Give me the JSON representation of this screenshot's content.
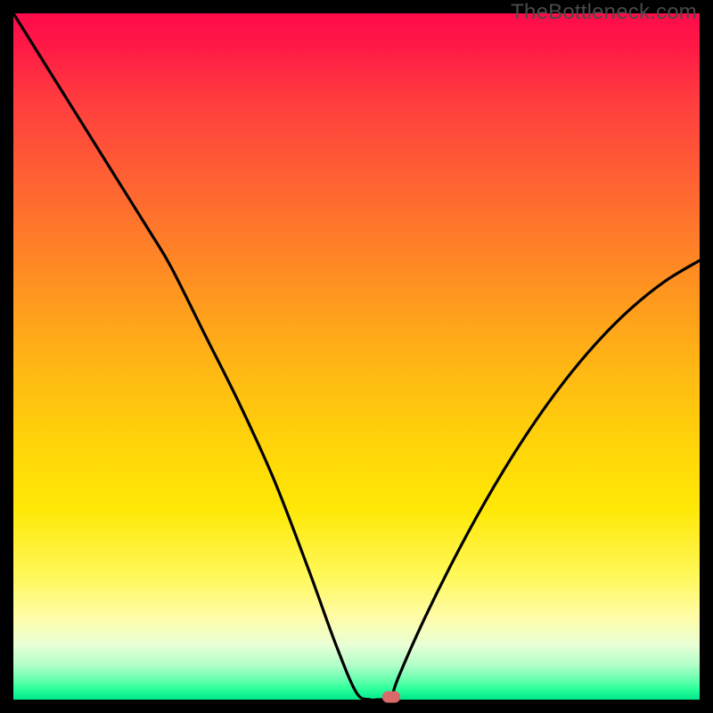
{
  "watermark": "TheBottleneck.com",
  "chart_data": {
    "type": "line",
    "title": "",
    "xlabel": "",
    "ylabel": "",
    "xlim": [
      0,
      100
    ],
    "ylim": [
      0,
      100
    ],
    "grid": false,
    "legend": false,
    "background_gradient": {
      "top": "#ff0a4a",
      "bottom": "#00e88a",
      "description": "red-to-green vertical gradient (bottleneck severity scale)"
    },
    "series": [
      {
        "name": "bottleneck-curve",
        "color": "#000000",
        "x": [
          0,
          5,
          10,
          15,
          20,
          23,
          28,
          33,
          38,
          43,
          47,
          50,
          52,
          53,
          54,
          55,
          56,
          60,
          65,
          70,
          75,
          80,
          85,
          90,
          95,
          100
        ],
        "values": [
          100,
          92,
          84,
          76,
          68,
          63,
          53,
          43,
          32,
          19,
          8,
          1,
          0,
          0,
          0,
          0,
          3,
          12,
          22,
          31,
          39,
          46,
          52,
          57,
          61,
          64
        ]
      }
    ],
    "marker": {
      "name": "optimal-point",
      "x": 55,
      "y": 0,
      "color": "#d96a6a"
    }
  }
}
